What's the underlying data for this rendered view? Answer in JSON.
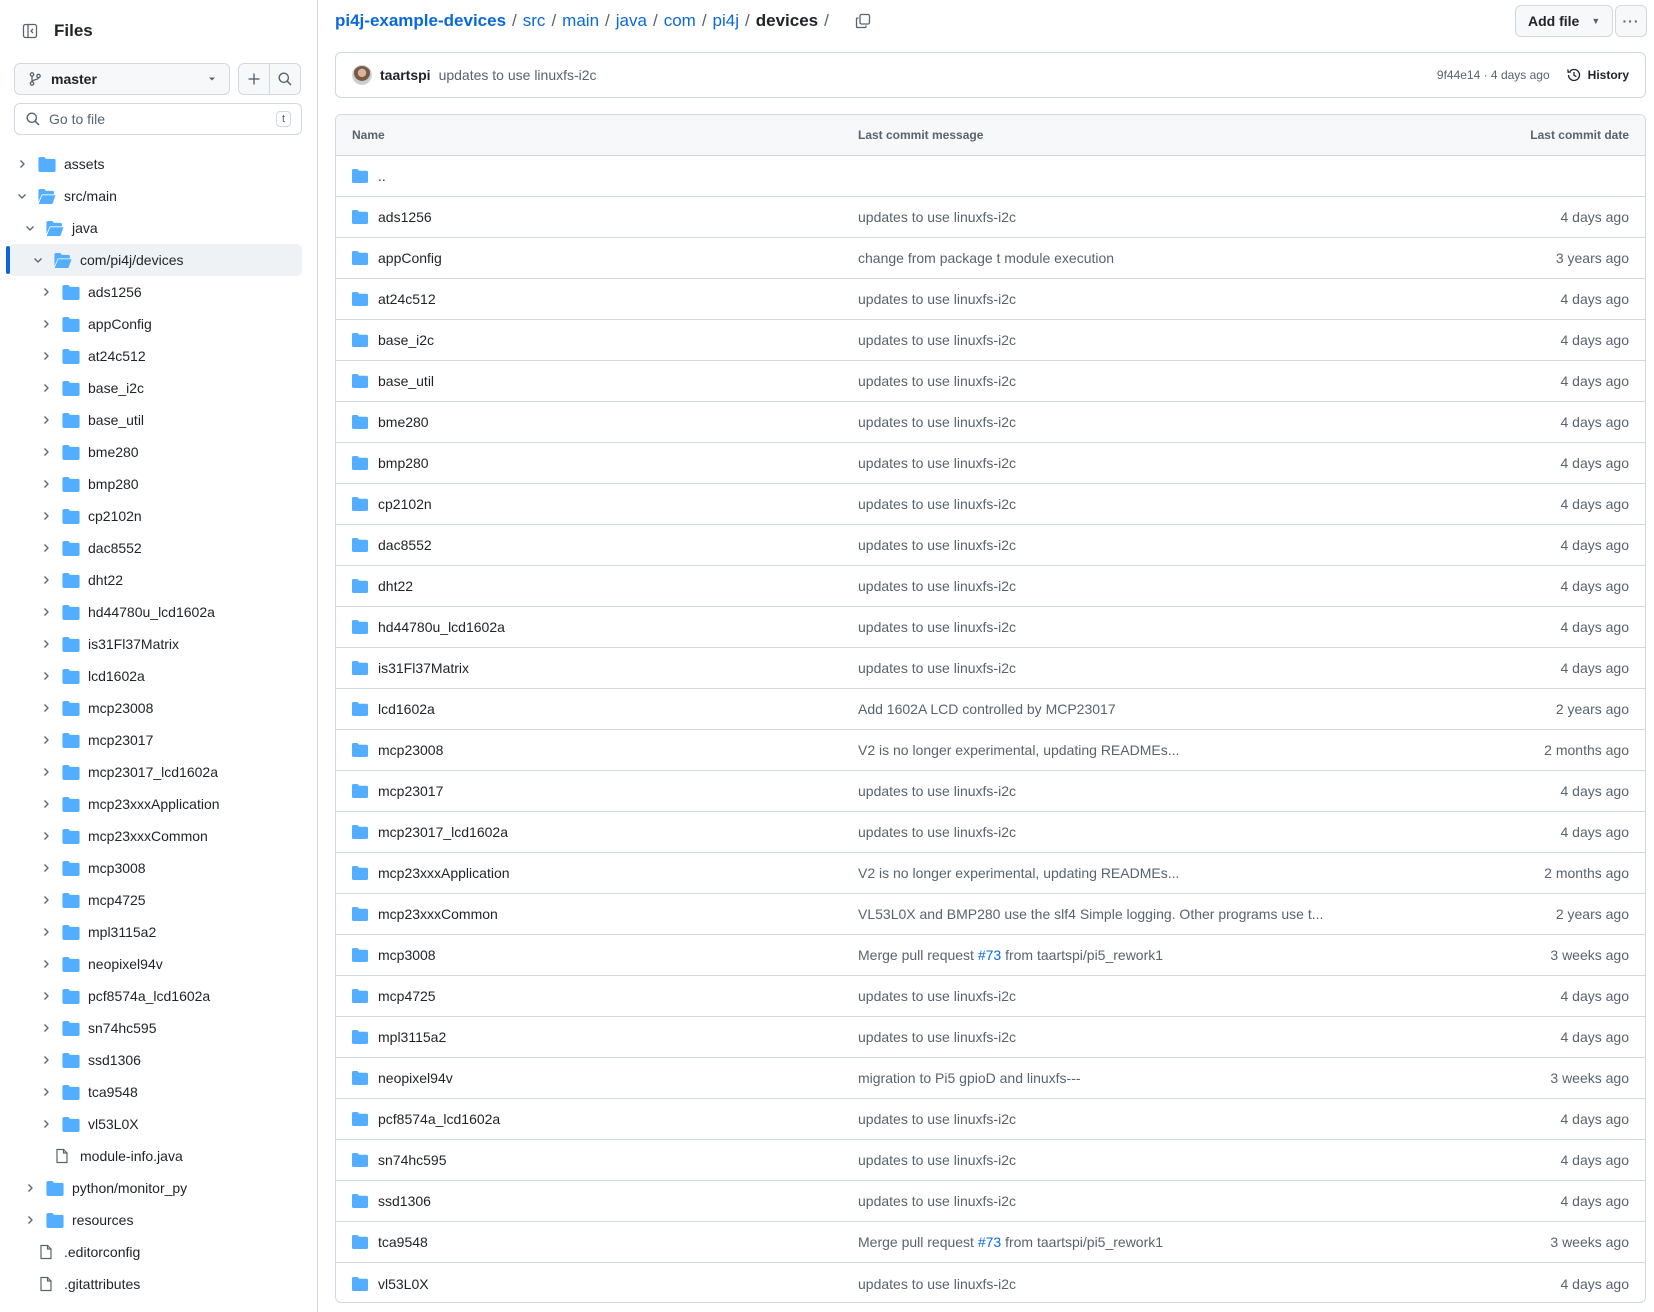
{
  "sidebar": {
    "title": "Files",
    "branch": "master",
    "goto_placeholder": "Go to file",
    "goto_shortcut": "t",
    "tree": [
      {
        "label": "assets",
        "type": "folder",
        "depth": 0,
        "expanded": false
      },
      {
        "label": "src/main",
        "type": "folder",
        "depth": 0,
        "expanded": true
      },
      {
        "label": "java",
        "type": "folder",
        "depth": 1,
        "expanded": true
      },
      {
        "label": "com/pi4j/devices",
        "type": "folder",
        "depth": 2,
        "expanded": true,
        "selected": true
      },
      {
        "label": "ads1256",
        "type": "folder",
        "depth": 3,
        "expanded": false
      },
      {
        "label": "appConfig",
        "type": "folder",
        "depth": 3,
        "expanded": false
      },
      {
        "label": "at24c512",
        "type": "folder",
        "depth": 3,
        "expanded": false
      },
      {
        "label": "base_i2c",
        "type": "folder",
        "depth": 3,
        "expanded": false
      },
      {
        "label": "base_util",
        "type": "folder",
        "depth": 3,
        "expanded": false
      },
      {
        "label": "bme280",
        "type": "folder",
        "depth": 3,
        "expanded": false
      },
      {
        "label": "bmp280",
        "type": "folder",
        "depth": 3,
        "expanded": false
      },
      {
        "label": "cp2102n",
        "type": "folder",
        "depth": 3,
        "expanded": false
      },
      {
        "label": "dac8552",
        "type": "folder",
        "depth": 3,
        "expanded": false
      },
      {
        "label": "dht22",
        "type": "folder",
        "depth": 3,
        "expanded": false
      },
      {
        "label": "hd44780u_lcd1602a",
        "type": "folder",
        "depth": 3,
        "expanded": false
      },
      {
        "label": "is31Fl37Matrix",
        "type": "folder",
        "depth": 3,
        "expanded": false
      },
      {
        "label": "lcd1602a",
        "type": "folder",
        "depth": 3,
        "expanded": false
      },
      {
        "label": "mcp23008",
        "type": "folder",
        "depth": 3,
        "expanded": false
      },
      {
        "label": "mcp23017",
        "type": "folder",
        "depth": 3,
        "expanded": false
      },
      {
        "label": "mcp23017_lcd1602a",
        "type": "folder",
        "depth": 3,
        "expanded": false
      },
      {
        "label": "mcp23xxxApplication",
        "type": "folder",
        "depth": 3,
        "expanded": false
      },
      {
        "label": "mcp23xxxCommon",
        "type": "folder",
        "depth": 3,
        "expanded": false
      },
      {
        "label": "mcp3008",
        "type": "folder",
        "depth": 3,
        "expanded": false
      },
      {
        "label": "mcp4725",
        "type": "folder",
        "depth": 3,
        "expanded": false
      },
      {
        "label": "mpl3115a2",
        "type": "folder",
        "depth": 3,
        "expanded": false
      },
      {
        "label": "neopixel94v",
        "type": "folder",
        "depth": 3,
        "expanded": false
      },
      {
        "label": "pcf8574a_lcd1602a",
        "type": "folder",
        "depth": 3,
        "expanded": false
      },
      {
        "label": "sn74hc595",
        "type": "folder",
        "depth": 3,
        "expanded": false
      },
      {
        "label": "ssd1306",
        "type": "folder",
        "depth": 3,
        "expanded": false
      },
      {
        "label": "tca9548",
        "type": "folder",
        "depth": 3,
        "expanded": false
      },
      {
        "label": "vl53L0X",
        "type": "folder",
        "depth": 3,
        "expanded": false
      },
      {
        "label": "module-info.java",
        "type": "file",
        "depth": 2
      },
      {
        "label": "python/monitor_py",
        "type": "folder",
        "depth": 1,
        "expanded": false
      },
      {
        "label": "resources",
        "type": "folder",
        "depth": 1,
        "expanded": false
      },
      {
        "label": ".editorconfig",
        "type": "file",
        "depth": 0
      },
      {
        "label": ".gitattributes",
        "type": "file",
        "depth": 0
      }
    ]
  },
  "breadcrumb": {
    "repo": "pi4j-example-devices",
    "parts": [
      "src",
      "main",
      "java",
      "com",
      "pi4j"
    ],
    "current": "devices",
    "trailing": "/"
  },
  "actions": {
    "add_file": "Add file",
    "more": "···"
  },
  "commit": {
    "author": "taartspi",
    "message": "updates to use linuxfs-i2c",
    "meta": "9f44e14 · 4 days ago",
    "history": "History"
  },
  "table": {
    "headers": {
      "name": "Name",
      "message": "Last commit message",
      "date": "Last commit date"
    },
    "parent": "..",
    "rows": [
      {
        "name": "ads1256",
        "message": "updates to use linuxfs-i2c",
        "date": "4 days ago"
      },
      {
        "name": "appConfig",
        "message": "change from package t module execution",
        "date": "3 years ago"
      },
      {
        "name": "at24c512",
        "message": "updates to use linuxfs-i2c",
        "date": "4 days ago"
      },
      {
        "name": "base_i2c",
        "message": "updates to use linuxfs-i2c",
        "date": "4 days ago"
      },
      {
        "name": "base_util",
        "message": "updates to use linuxfs-i2c",
        "date": "4 days ago"
      },
      {
        "name": "bme280",
        "message": "updates to use linuxfs-i2c",
        "date": "4 days ago"
      },
      {
        "name": "bmp280",
        "message": "updates to use linuxfs-i2c",
        "date": "4 days ago"
      },
      {
        "name": "cp2102n",
        "message": "updates to use linuxfs-i2c",
        "date": "4 days ago"
      },
      {
        "name": "dac8552",
        "message": "updates to use linuxfs-i2c",
        "date": "4 days ago"
      },
      {
        "name": "dht22",
        "message": "updates to use linuxfs-i2c",
        "date": "4 days ago"
      },
      {
        "name": "hd44780u_lcd1602a",
        "message": "updates to use linuxfs-i2c",
        "date": "4 days ago"
      },
      {
        "name": "is31Fl37Matrix",
        "message": "updates to use linuxfs-i2c",
        "date": "4 days ago"
      },
      {
        "name": "lcd1602a",
        "message": "Add 1602A LCD controlled by MCP23017",
        "date": "2 years ago"
      },
      {
        "name": "mcp23008",
        "message": "V2 is no longer experimental, updating READMEs...",
        "date": "2 months ago"
      },
      {
        "name": "mcp23017",
        "message": "updates to use linuxfs-i2c",
        "date": "4 days ago"
      },
      {
        "name": "mcp23017_lcd1602a",
        "message": "updates to use linuxfs-i2c",
        "date": "4 days ago"
      },
      {
        "name": "mcp23xxxApplication",
        "message": "V2 is no longer experimental, updating READMEs...",
        "date": "2 months ago"
      },
      {
        "name": "mcp23xxxCommon",
        "message": "VL53L0X and BMP280 use the slf4 Simple logging. Other programs use t...",
        "date": "2 years ago"
      },
      {
        "name": "mcp3008",
        "message": "Merge pull request ",
        "link": "#73",
        "message_after": " from taartspi/pi5_rework1",
        "date": "3 weeks ago"
      },
      {
        "name": "mcp4725",
        "message": "updates to use linuxfs-i2c",
        "date": "4 days ago"
      },
      {
        "name": "mpl3115a2",
        "message": "updates to use linuxfs-i2c",
        "date": "4 days ago"
      },
      {
        "name": "neopixel94v",
        "message": "migration to Pi5 gpioD and linuxfs---",
        "date": "3 weeks ago"
      },
      {
        "name": "pcf8574a_lcd1602a",
        "message": "updates to use linuxfs-i2c",
        "date": "4 days ago"
      },
      {
        "name": "sn74hc595",
        "message": "updates to use linuxfs-i2c",
        "date": "4 days ago"
      },
      {
        "name": "ssd1306",
        "message": "updates to use linuxfs-i2c",
        "date": "4 days ago"
      },
      {
        "name": "tca9548",
        "message": "Merge pull request ",
        "link": "#73",
        "message_after": " from taartspi/pi5_rework1",
        "date": "3 weeks ago"
      },
      {
        "name": "vl53L0X",
        "message": "updates to use linuxfs-i2c",
        "date": "4 days ago"
      }
    ]
  },
  "colors": {
    "folder": "#54aeff",
    "link": "#0969da",
    "muted": "#59636e",
    "accent": "#0969da"
  }
}
